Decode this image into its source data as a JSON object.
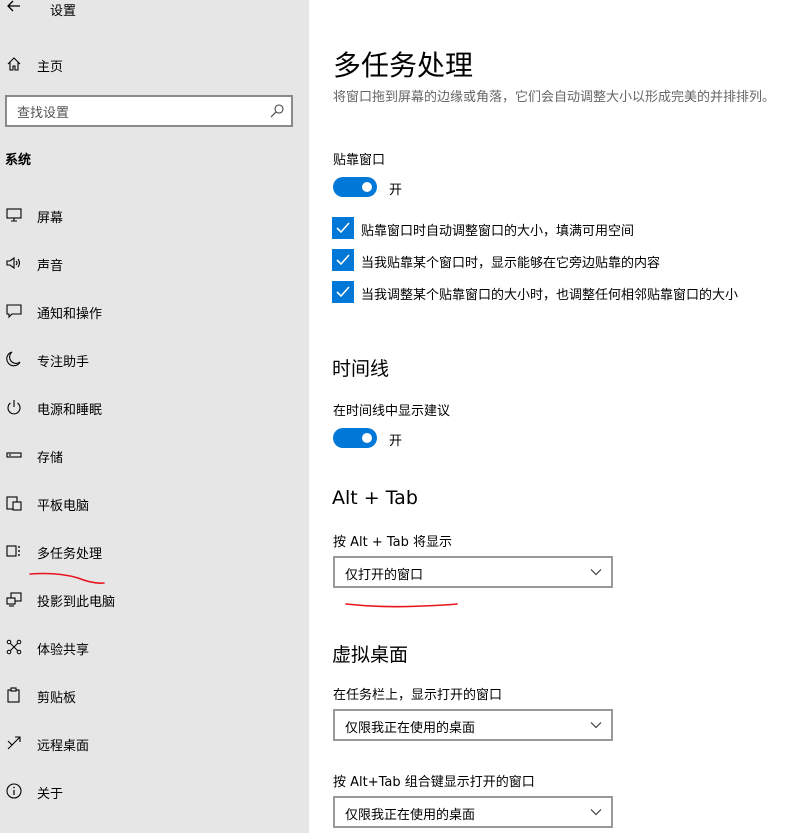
{
  "app": {
    "title": "设置"
  },
  "sidebar": {
    "home_label": "主页",
    "search_placeholder": "查找设置",
    "section": "系统",
    "items": [
      {
        "label": "屏幕",
        "icon": "monitor-icon"
      },
      {
        "label": "声音",
        "icon": "speaker-icon"
      },
      {
        "label": "通知和操作",
        "icon": "notification-icon"
      },
      {
        "label": "专注助手",
        "icon": "moon-icon"
      },
      {
        "label": "电源和睡眠",
        "icon": "power-icon"
      },
      {
        "label": "存储",
        "icon": "storage-icon"
      },
      {
        "label": "平板电脑",
        "icon": "tablet-icon"
      },
      {
        "label": "多任务处理",
        "icon": "multitasking-icon"
      },
      {
        "label": "投影到此电脑",
        "icon": "project-icon"
      },
      {
        "label": "体验共享",
        "icon": "share-icon"
      },
      {
        "label": "剪贴板",
        "icon": "clipboard-icon"
      },
      {
        "label": "远程桌面",
        "icon": "remote-icon"
      },
      {
        "label": "关于",
        "icon": "info-icon"
      }
    ]
  },
  "main": {
    "title": "多任务处理",
    "description": "将窗口拖到屏幕的边缘或角落，它们会自动调整大小以形成完美的并排排列。",
    "snap": {
      "label": "贴靠窗口",
      "toggle_state": "开",
      "options": [
        "贴靠窗口时自动调整窗口的大小，填满可用空间",
        "当我贴靠某个窗口时，显示能够在它旁边贴靠的内容",
        "当我调整某个贴靠窗口的大小时，也调整任何相邻贴靠窗口的大小"
      ]
    },
    "timeline": {
      "heading": "时间线",
      "label": "在时间线中显示建议",
      "toggle_state": "开"
    },
    "alttab": {
      "heading": "Alt + Tab",
      "label": "按 Alt + Tab 将显示",
      "value": "仅打开的窗口"
    },
    "virtual_desktops": {
      "heading": "虚拟桌面",
      "taskbar_label": "在任务栏上，显示打开的窗口",
      "taskbar_value": "仅限我正在使用的桌面",
      "alttab_label": "按 Alt+Tab 组合键显示打开的窗口",
      "alttab_value": "仅限我正在使用的桌面"
    }
  },
  "colors": {
    "accent": "#0078d7",
    "annotation": "#e8141c",
    "sidebar_bg": "#e6e6e6"
  }
}
